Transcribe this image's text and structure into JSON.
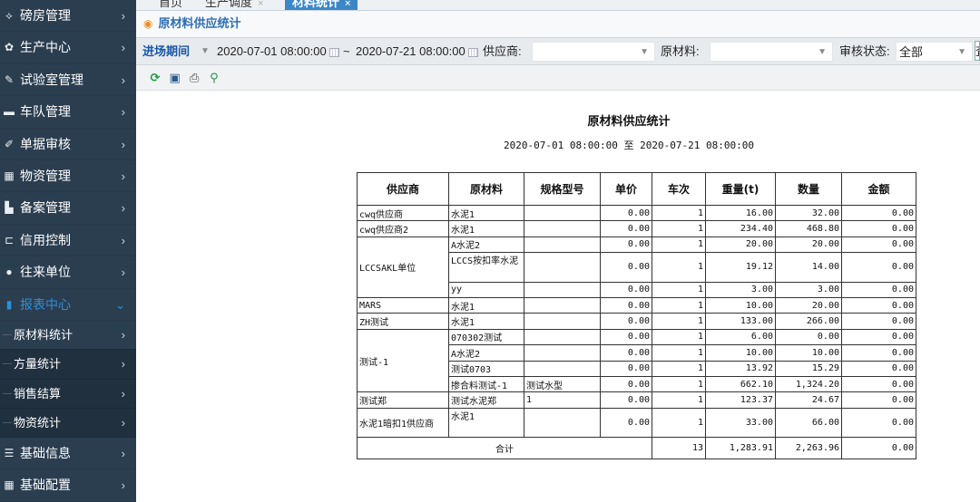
{
  "sidebar": {
    "items": [
      {
        "icon": "scale-icon",
        "glyph": "⟡",
        "label": "磅房管理"
      },
      {
        "icon": "gear-icon",
        "glyph": "✿",
        "label": "生产中心"
      },
      {
        "icon": "flask-icon",
        "glyph": "✎",
        "label": "试验室管理"
      },
      {
        "icon": "truck-icon",
        "glyph": "▬",
        "label": "车队管理"
      },
      {
        "icon": "edit-icon",
        "glyph": "✐",
        "label": "单据审核"
      },
      {
        "icon": "grid-icon",
        "glyph": "▦",
        "label": "物资管理"
      },
      {
        "icon": "file-icon",
        "glyph": "▙",
        "label": "备案管理"
      },
      {
        "icon": "credit-icon",
        "glyph": "⊏",
        "label": "信用控制"
      },
      {
        "icon": "user-icon",
        "glyph": "●",
        "label": "往来单位"
      },
      {
        "icon": "bar-chart-icon",
        "glyph": "▮",
        "label": "报表中心"
      }
    ],
    "sub_items": [
      {
        "label": "原材料统计"
      },
      {
        "label": "方量统计"
      },
      {
        "label": "销售结算"
      },
      {
        "label": "物资统计"
      }
    ],
    "bottom_items": [
      {
        "icon": "list-icon",
        "glyph": "☰",
        "label": "基础信息"
      },
      {
        "icon": "grid-icon",
        "glyph": "▦",
        "label": "基础配置"
      }
    ],
    "arrow": "›",
    "arrow_open": "⌄",
    "dash": "—"
  },
  "tabs": [
    {
      "label": "首页",
      "close": ""
    },
    {
      "label": "生产调度",
      "close": "×"
    },
    {
      "label": "材料统计",
      "close": "×"
    }
  ],
  "page_title": "原材料供应统计",
  "filter": {
    "date_label": "进场期间",
    "start": "2020-07-01 08:00:00",
    "tilde": "~",
    "end": "2020-07-21 08:00:00",
    "supplier_label": "供应商:",
    "supplier_value": "",
    "material_label": "原材料:",
    "material_value": "",
    "status_label": "审核状态:",
    "status_value": "全部",
    "more": "査"
  },
  "report": {
    "title": "原材料供应统计",
    "range": "2020-07-01 08:00:00 至 2020-07-21 08:00:00",
    "headers": [
      "供应商",
      "原材料",
      "规格型号",
      "单价",
      "车次",
      "重量(t)",
      "数量",
      "金额"
    ],
    "groups": [
      {
        "supplier": "cwq供应商",
        "rows": [
          {
            "material": "水泥1",
            "spec": "",
            "price": "0.00",
            "trips": "1",
            "weight": "16.00",
            "qty": "32.00",
            "amount": "0.00"
          }
        ]
      },
      {
        "supplier": "cwq供应商2",
        "rows": [
          {
            "material": "水泥1",
            "spec": "",
            "price": "0.00",
            "trips": "1",
            "weight": "234.40",
            "qty": "468.80",
            "amount": "0.00"
          }
        ]
      },
      {
        "supplier": "LCCSAKL单位",
        "rows": [
          {
            "material": "A水泥2",
            "spec": "",
            "price": "0.00",
            "trips": "1",
            "weight": "20.00",
            "qty": "20.00",
            "amount": "0.00"
          },
          {
            "material": "LCCS按扣率水泥",
            "spec": "",
            "price": "0.00",
            "trips": "1",
            "weight": "19.12",
            "qty": "14.00",
            "amount": "0.00",
            "tall": true
          },
          {
            "material": "yy",
            "spec": "",
            "price": "0.00",
            "trips": "1",
            "weight": "3.00",
            "qty": "3.00",
            "amount": "0.00"
          }
        ]
      },
      {
        "supplier": "MARS",
        "rows": [
          {
            "material": "水泥1",
            "spec": "",
            "price": "0.00",
            "trips": "1",
            "weight": "10.00",
            "qty": "20.00",
            "amount": "0.00"
          }
        ]
      },
      {
        "supplier": "ZH测试",
        "rows": [
          {
            "material": "水泥1",
            "spec": "",
            "price": "0.00",
            "trips": "1",
            "weight": "133.00",
            "qty": "266.00",
            "amount": "0.00"
          }
        ]
      },
      {
        "supplier": "测试-1",
        "rows": [
          {
            "material": "070302测试",
            "spec": "",
            "price": "0.00",
            "trips": "1",
            "weight": "6.00",
            "qty": "0.00",
            "amount": "0.00"
          },
          {
            "material": "A水泥2",
            "spec": "",
            "price": "0.00",
            "trips": "1",
            "weight": "10.00",
            "qty": "10.00",
            "amount": "0.00"
          },
          {
            "material": "测试0703",
            "spec": "",
            "price": "0.00",
            "trips": "1",
            "weight": "13.92",
            "qty": "15.29",
            "amount": "0.00"
          },
          {
            "material": "掺合料测试-1",
            "spec": "测试水型",
            "price": "0.00",
            "trips": "1",
            "weight": "662.10",
            "qty": "1,324.20",
            "amount": "0.00"
          }
        ]
      },
      {
        "supplier": "测试郑",
        "rows": [
          {
            "material": "测试水泥郑",
            "spec": "1",
            "price": "0.00",
            "trips": "1",
            "weight": "123.37",
            "qty": "24.67",
            "amount": "0.00"
          }
        ]
      },
      {
        "supplier": "水泥1暗扣1供应商",
        "rows": [
          {
            "material": "水泥1",
            "spec": "",
            "price": "0.00",
            "trips": "1",
            "weight": "33.00",
            "qty": "66.00",
            "amount": "0.00",
            "tall": true
          }
        ]
      }
    ],
    "total": {
      "label": "合计",
      "trips": "13",
      "weight": "1,283.91",
      "qty": "2,263.96",
      "amount": "0.00"
    }
  },
  "toolbar": {
    "refresh": "⟳",
    "save": "▣",
    "print": "⎙",
    "zoom": "⚲"
  }
}
